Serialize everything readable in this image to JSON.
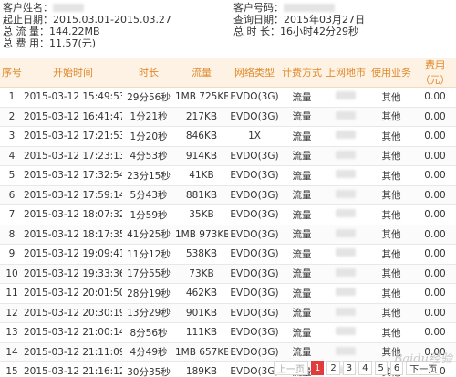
{
  "summary": {
    "left": [
      {
        "label": "客户姓名：",
        "value": ""
      },
      {
        "label": "起止日期：",
        "value": "2015.03.01-2015.03.27"
      },
      {
        "label": "总 流 量：",
        "value": "144.22MB"
      },
      {
        "label": "总 费 用：",
        "value": "11.57(元)"
      }
    ],
    "right": [
      {
        "label": "客户号码：",
        "value": ""
      },
      {
        "label": "查询日期：",
        "value": "2015年03月27日"
      },
      {
        "label": "总 时 长：",
        "value": "16小时42分29秒"
      }
    ]
  },
  "table": {
    "headers": [
      "序号",
      "开始时间",
      "时长",
      "流量",
      "网络类型",
      "计费方式",
      "上网地市",
      "使用业务",
      "费用（元）"
    ],
    "rows": [
      [
        "1",
        "2015-03-12 15:49:53",
        "29分56秒",
        "1MB 725KB",
        "EVDO(3G)",
        "流量",
        "",
        "其他",
        "0.00"
      ],
      [
        "2",
        "2015-03-12 16:41:47",
        "1分21秒",
        "217KB",
        "EVDO(3G)",
        "流量",
        "",
        "其他",
        "0.00"
      ],
      [
        "3",
        "2015-03-12 17:21:53",
        "1分20秒",
        "846KB",
        "1X",
        "流量",
        "",
        "其他",
        "0.00"
      ],
      [
        "4",
        "2015-03-12 17:23:13",
        "4分53秒",
        "914KB",
        "EVDO(3G)",
        "流量",
        "",
        "其他",
        "0.00"
      ],
      [
        "5",
        "2015-03-12 17:32:54",
        "23分15秒",
        "41KB",
        "EVDO(3G)",
        "流量",
        "",
        "其他",
        "0.00"
      ],
      [
        "6",
        "2015-03-12 17:59:14",
        "5分43秒",
        "881KB",
        "EVDO(3G)",
        "流量",
        "",
        "其他",
        "0.00"
      ],
      [
        "7",
        "2015-03-12 18:07:32",
        "1分59秒",
        "35KB",
        "EVDO(3G)",
        "流量",
        "",
        "其他",
        "0.00"
      ],
      [
        "8",
        "2015-03-12 18:17:35",
        "41分25秒",
        "1MB 973KB",
        "EVDO(3G)",
        "流量",
        "",
        "其他",
        "0.00"
      ],
      [
        "9",
        "2015-03-12 19:09:41",
        "11分12秒",
        "538KB",
        "EVDO(3G)",
        "流量",
        "",
        "其他",
        "0.00"
      ],
      [
        "10",
        "2015-03-12 19:33:36",
        "17分55秒",
        "73KB",
        "EVDO(3G)",
        "流量",
        "",
        "其他",
        "0.00"
      ],
      [
        "11",
        "2015-03-12 20:01:50",
        "28分19秒",
        "462KB",
        "EVDO(3G)",
        "流量",
        "",
        "其他",
        "0.00"
      ],
      [
        "12",
        "2015-03-12 20:30:19",
        "13分29秒",
        "901KB",
        "EVDO(3G)",
        "流量",
        "",
        "其他",
        "0.00"
      ],
      [
        "13",
        "2015-03-12 21:00:14",
        "8分56秒",
        "111KB",
        "EVDO(3G)",
        "流量",
        "",
        "其他",
        "0.00"
      ],
      [
        "14",
        "2015-03-12 21:11:09",
        "4分49秒",
        "1MB 657KB",
        "EVDO(3G)",
        "流量",
        "",
        "其他",
        "0.00"
      ],
      [
        "15",
        "2015-03-12 21:16:12",
        "30分35秒",
        "189KB",
        "EVDO(3G)",
        "流量",
        "",
        "其他",
        "0.00"
      ]
    ]
  },
  "pagination": {
    "prev_label": "上一页",
    "pages": [
      "1",
      "2",
      "3",
      "4",
      "5",
      "6"
    ],
    "active_page": "1",
    "next_label": "下一页"
  },
  "watermark": "Baidu经验",
  "colors": {
    "header_bg": "#fdf2e3",
    "header_text": "#e08a2e",
    "active_page": "#e23b3b"
  }
}
